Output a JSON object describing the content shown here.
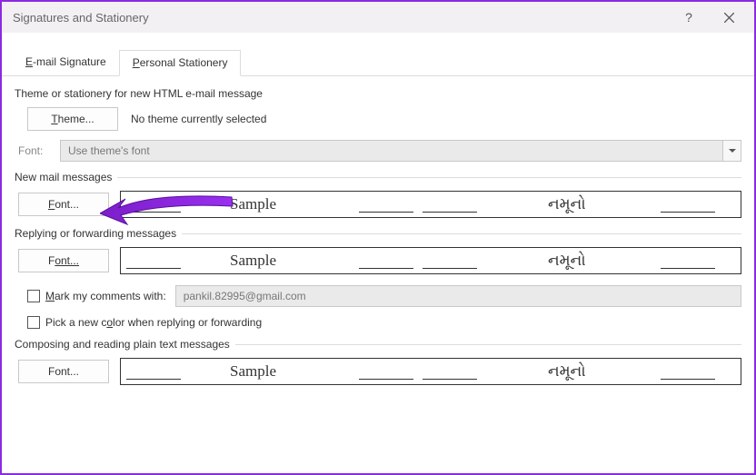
{
  "window": {
    "title": "Signatures and Stationery"
  },
  "tabs": {
    "email_signature": {
      "prefix": "E",
      "rest": "-mail Signature"
    },
    "personal_stationery": {
      "prefix": "P",
      "rest": "ersonal Stationery"
    }
  },
  "theme_section": {
    "heading": "Theme or stationery for new HTML e-mail message",
    "theme_btn_prefix": "T",
    "theme_btn_rest": "heme...",
    "status": "No theme currently selected",
    "font_label": "Font:",
    "font_value": "Use theme's font"
  },
  "new_mail": {
    "heading": "New mail messages",
    "font_btn_prefix": "F",
    "font_btn_rest": "ont...",
    "sample_en": "Sample",
    "sample_alt": "નમૂનો"
  },
  "reply": {
    "heading": "Replying or forwarding messages",
    "font_btn_prefix": "F",
    "font_btn_rest": "ont...",
    "sample_en": "Sample",
    "sample_alt": "નમૂનો",
    "mark_prefix": "M",
    "mark_rest": "ark my comments with:",
    "mark_value": "pankil.82995@gmail.com",
    "pick_color_prefix1": "Pick a new c",
    "pick_color_ul": "o",
    "pick_color_rest": "lor when replying or forwarding"
  },
  "plain": {
    "heading": "Composing and reading plain text messages",
    "font_btn_prefix": "F",
    "font_btn_rest": "ont...",
    "sample_en": "Sample",
    "sample_alt": "નમૂનો"
  }
}
